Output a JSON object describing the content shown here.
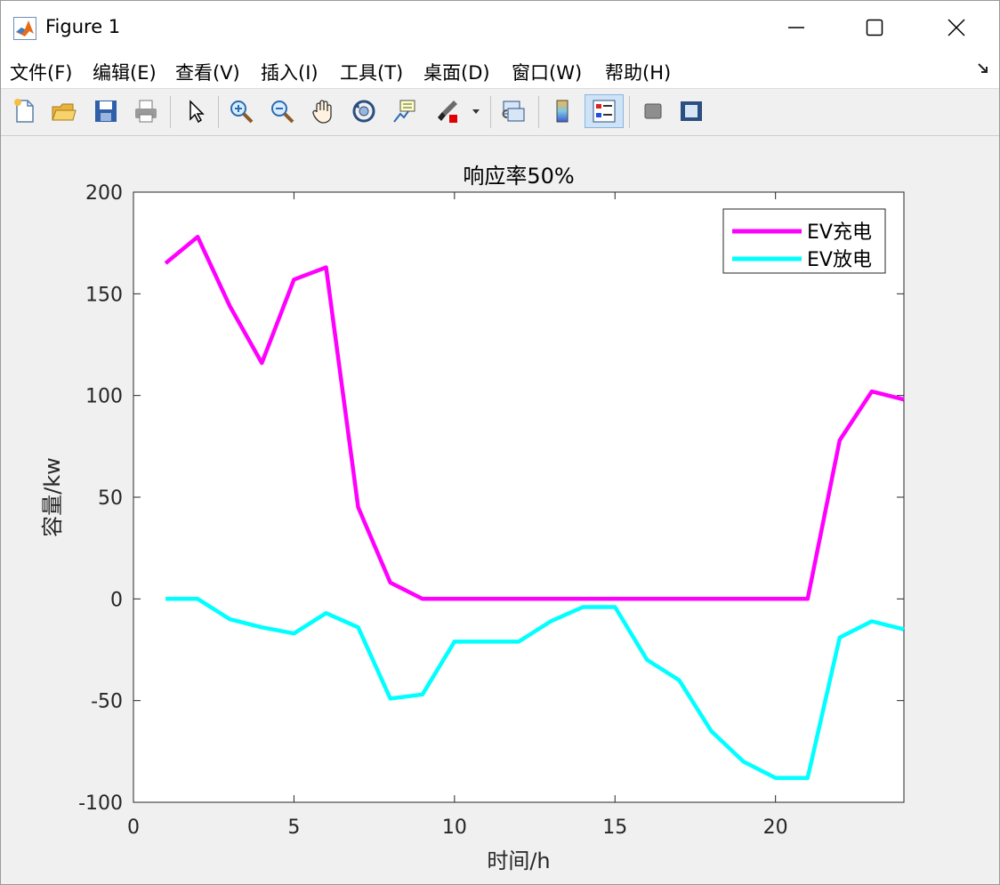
{
  "window": {
    "title": "Figure 1",
    "controls": {
      "minimize": "—",
      "maximize": "☐",
      "close": "✕"
    }
  },
  "menu": {
    "items": [
      "文件(F)",
      "编辑(E)",
      "查看(V)",
      "插入(I)",
      "工具(T)",
      "桌面(D)",
      "窗口(W)",
      "帮助(H)"
    ],
    "overflow_icon": "dock-arrow-icon"
  },
  "toolbar": {
    "icons": [
      "new-figure-icon",
      "open-file-icon",
      "save-icon",
      "print-icon",
      "select-arrow-icon",
      "zoom-in-icon",
      "zoom-out-icon",
      "pan-hand-icon",
      "rotate-3d-icon",
      "data-cursor-icon",
      "brush-icon",
      "brush-dropdown-icon",
      "link-plot-icon",
      "colorbar-icon",
      "legend-icon",
      "hide-plot-tools-icon",
      "show-plot-tools-icon"
    ],
    "active": "legend-icon"
  },
  "colors": {
    "charge": "#ff00ff",
    "discharge": "#00ffff",
    "axes_bg": "#ffffff"
  },
  "chart_data": {
    "type": "line",
    "title": "响应率50%",
    "xlabel": "时间/h",
    "ylabel": "容量/kw",
    "xlim": [
      0,
      24
    ],
    "ylim": [
      -100,
      200
    ],
    "xticks": [
      0,
      5,
      10,
      15,
      20
    ],
    "yticks": [
      -100,
      -50,
      0,
      50,
      100,
      150,
      200
    ],
    "legend_position": "top-right",
    "grid": false,
    "x": [
      1,
      2,
      3,
      4,
      5,
      6,
      7,
      8,
      9,
      10,
      11,
      12,
      13,
      14,
      15,
      16,
      17,
      18,
      19,
      20,
      21,
      22,
      23,
      24
    ],
    "series": [
      {
        "name": "EV充电",
        "color": "#ff00ff",
        "values": [
          165,
          178,
          144,
          116,
          157,
          163,
          45,
          8,
          0,
          0,
          0,
          0,
          0,
          0,
          0,
          0,
          0,
          0,
          0,
          0,
          0,
          78,
          102,
          98
        ]
      },
      {
        "name": "EV放电",
        "color": "#00ffff",
        "values": [
          0,
          0,
          -10,
          -14,
          -17,
          -7,
          -14,
          -49,
          -47,
          -21,
          -21,
          -21,
          -11,
          -4,
          -4,
          -30,
          -40,
          -65,
          -80,
          -88,
          -88,
          -19,
          -11,
          -15
        ]
      }
    ]
  }
}
